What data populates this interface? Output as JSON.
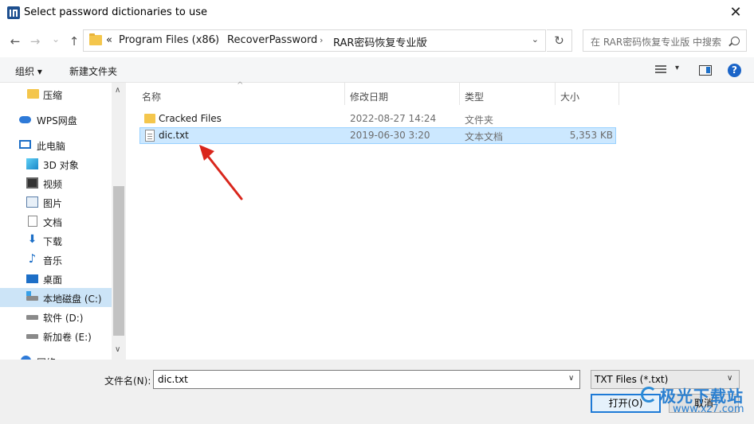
{
  "window": {
    "title": "Select password dictionaries to use",
    "close_glyph": "✕"
  },
  "nav": {
    "back_glyph": "←",
    "forward_glyph": "→",
    "recent_glyph": "⌄",
    "up_glyph": "↑",
    "address": {
      "overflow": "«",
      "crumbs": [
        "Program Files (x86)",
        "RecoverPassword",
        "RAR密码恢复专业版"
      ],
      "separator": "›",
      "dropdown_glyph": "⌄"
    },
    "refresh_glyph": "↻",
    "search_placeholder": "在 RAR密码恢复专业版 中搜索"
  },
  "commandbar": {
    "organize": "组织 ▾",
    "new_folder": "新建文件夹",
    "view_drop": "▾",
    "help": "?"
  },
  "sidebar": {
    "items": [
      {
        "label": "压缩",
        "icon": "folder-icon"
      },
      {
        "label": "WPS网盘",
        "icon": "cloud-icon"
      },
      {
        "label": "此电脑",
        "icon": "computer-icon"
      },
      {
        "label": "3D 对象",
        "icon": "3d-objects-icon"
      },
      {
        "label": "视频",
        "icon": "video-icon"
      },
      {
        "label": "图片",
        "icon": "pictures-icon"
      },
      {
        "label": "文档",
        "icon": "documents-icon"
      },
      {
        "label": "下载",
        "icon": "download-icon"
      },
      {
        "label": "音乐",
        "icon": "music-icon"
      },
      {
        "label": "桌面",
        "icon": "desktop-icon"
      },
      {
        "label": "本地磁盘 (C:)",
        "icon": "drive-icon",
        "selected": true
      },
      {
        "label": "软件 (D:)",
        "icon": "drive-icon"
      },
      {
        "label": "新加卷 (E:)",
        "icon": "drive-icon"
      },
      {
        "label": "网络",
        "icon": "network-icon"
      }
    ],
    "scroll_up": "∧",
    "scroll_down": "∨"
  },
  "filelist": {
    "sort_indicator": "^",
    "columns": {
      "name": "名称",
      "date": "修改日期",
      "type": "类型",
      "size": "大小"
    },
    "rows": [
      {
        "name": "Cracked Files",
        "date": "2022-08-27 14:24",
        "type": "文件夹",
        "size": "",
        "icon": "folder-icon"
      },
      {
        "name": "dic.txt",
        "date": "2019-06-30 3:20",
        "type": "文本文档",
        "size": "5,353 KB",
        "icon": "text-file-icon",
        "selected": true
      }
    ]
  },
  "footer": {
    "filename_label": "文件名(N):",
    "filename_value": "dic.txt",
    "filter_value": "TXT Files (*.txt)",
    "dropdown_glyph": "∨",
    "open_button": "打开(O)",
    "cancel_button": "取消"
  },
  "watermark": {
    "text": "极光下载站",
    "url": "www.xz7.com"
  },
  "colors": {
    "selection": "#cce8ff",
    "accent": "#1e7ad6",
    "arrow": "#d9261c"
  }
}
